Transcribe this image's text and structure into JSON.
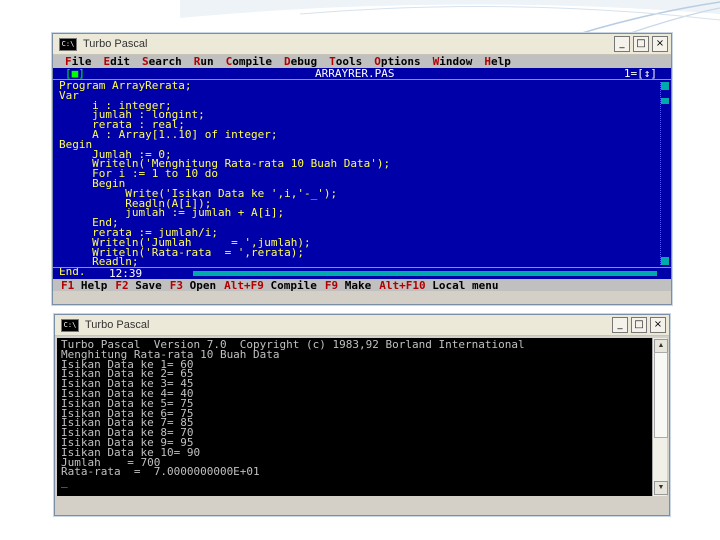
{
  "editor_window": {
    "title": "Turbo Pascal",
    "menu": [
      {
        "hot": "F",
        "rest": "ile"
      },
      {
        "hot": "E",
        "rest": "dit"
      },
      {
        "hot": "S",
        "rest": "earch"
      },
      {
        "hot": "R",
        "rest": "un"
      },
      {
        "hot": "C",
        "rest": "ompile"
      },
      {
        "hot": "D",
        "rest": "ebug"
      },
      {
        "hot": "T",
        "rest": "ools"
      },
      {
        "hot": "O",
        "rest": "ptions"
      },
      {
        "hot": "W",
        "rest": "indow"
      },
      {
        "hot": "H",
        "rest": "elp"
      }
    ],
    "file_name": "ARRAYRER.PAS",
    "close_box": "[■]",
    "window_number": "1=[↕]",
    "code_lines": [
      "Program ArrayRerata;",
      "Var",
      "     i : integer;",
      "     jumlah : longint;",
      "     rerata : real;",
      "     A : Array[1..10] of integer;",
      "Begin",
      "     Jumlah := 0;",
      "     Writeln('Menghitung Rata-rata 10 Buah Data');",
      "     For i := 1 to 10 do",
      "     Begin",
      "          Write('Isikan Data ke ',i,'-_');",
      "          Readln(A[i]);",
      "          jumlah := jumlah + A[i];",
      "     End;",
      "     rerata := jumlah/i;",
      "     Writeln('Jumlah      = ',jumlah);",
      "     Writeln('Rata-rata  = ',rerata);",
      "     Readln;",
      "End."
    ],
    "cursor_pos": "12:39",
    "status_items": [
      {
        "hot": "F1",
        "rest": " Help"
      },
      {
        "hot": "F2",
        "rest": " Save"
      },
      {
        "hot": "F3",
        "rest": " Open"
      },
      {
        "hot": "Alt+F9",
        "rest": " Compile"
      },
      {
        "hot": "F9",
        "rest": " Make"
      },
      {
        "hot": "Alt+F10",
        "rest": " Local menu"
      }
    ]
  },
  "output_window": {
    "title": "Turbo Pascal",
    "lines": [
      "Turbo Pascal  Version 7.0  Copyright (c) 1983,92 Borland International",
      "Menghitung Rata-rata 10 Buah Data",
      "Isikan Data ke 1= 60",
      "Isikan Data ke 2= 65",
      "Isikan Data ke 3= 45",
      "Isikan Data ke 4= 40",
      "Isikan Data ke 5= 75",
      "Isikan Data ke 6= 75",
      "Isikan Data ke 7= 85",
      "Isikan Data ke 8= 70",
      "Isikan Data ke 9= 95",
      "Isikan Data ke 10= 90",
      "Jumlah    = 700",
      "Rata-rata  =  7.0000000000E+01",
      "_"
    ]
  },
  "window_buttons": {
    "minimize": "_",
    "maximize": "□",
    "close": "×"
  },
  "colors": {
    "editor_bg": "#0000a8",
    "code_text": "#ffff55",
    "menu_bg": "#c0c0c0",
    "console_bg": "#000000",
    "console_text": "#c0c0c0"
  }
}
